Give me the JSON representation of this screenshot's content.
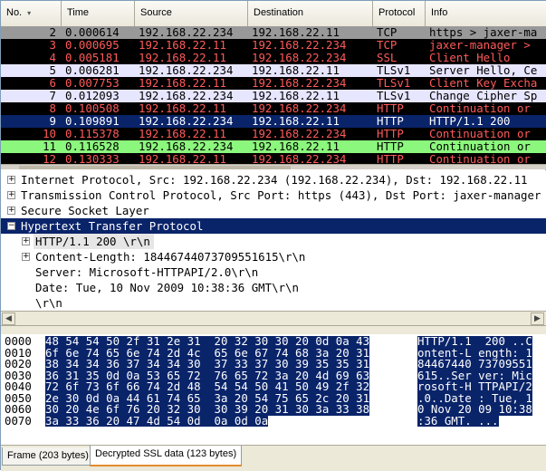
{
  "packet_list": {
    "columns": [
      "No.",
      "Time",
      "Source",
      "Destination",
      "Protocol",
      "Info"
    ],
    "sort_icon": "▾",
    "rows": [
      {
        "no": "2",
        "time": "0.000614",
        "src": "192.168.22.234",
        "dst": "192.168.22.11",
        "proto": "TCP",
        "info": "https > jaxer-ma",
        "bg": "#999999",
        "fg": "#000000"
      },
      {
        "no": "3",
        "time": "0.000695",
        "src": "192.168.22.11",
        "dst": "192.168.22.234",
        "proto": "TCP",
        "info": "jaxer-manager >",
        "bg": "#000000",
        "fg": "#ff5a5a"
      },
      {
        "no": "4",
        "time": "0.005181",
        "src": "192.168.22.11",
        "dst": "192.168.22.234",
        "proto": "SSL",
        "info": "Client Hello",
        "bg": "#000000",
        "fg": "#ff5a5a"
      },
      {
        "no": "5",
        "time": "0.006281",
        "src": "192.168.22.234",
        "dst": "192.168.22.11",
        "proto": "TLSv1",
        "info": "Server Hello, Ce",
        "bg": "#e7e6ff",
        "fg": "#000000"
      },
      {
        "no": "6",
        "time": "0.007753",
        "src": "192.168.22.11",
        "dst": "192.168.22.234",
        "proto": "TLSv1",
        "info": "Client Key Excha",
        "bg": "#000000",
        "fg": "#ff5a5a"
      },
      {
        "no": "7",
        "time": "0.012093",
        "src": "192.168.22.234",
        "dst": "192.168.22.11",
        "proto": "TLSv1",
        "info": "Change Cipher Sp",
        "bg": "#e7e6ff",
        "fg": "#000000"
      },
      {
        "no": "8",
        "time": "0.100508",
        "src": "192.168.22.11",
        "dst": "192.168.22.234",
        "proto": "HTTP",
        "info": "Continuation or",
        "bg": "#000000",
        "fg": "#ff5a5a"
      },
      {
        "no": "9",
        "time": "0.109891",
        "src": "192.168.22.234",
        "dst": "192.168.22.11",
        "proto": "HTTP",
        "info": "HTTP/1.1 200",
        "bg": "#0a246a",
        "fg": "#ffffff"
      },
      {
        "no": "10",
        "time": "0.115378",
        "src": "192.168.22.11",
        "dst": "192.168.22.234",
        "proto": "HTTP",
        "info": "Continuation or",
        "bg": "#000000",
        "fg": "#ff5a5a"
      },
      {
        "no": "11",
        "time": "0.116528",
        "src": "192.168.22.234",
        "dst": "192.168.22.11",
        "proto": "HTTP",
        "info": "Continuation or",
        "bg": "#8cf77d",
        "fg": "#000000"
      },
      {
        "no": "12",
        "time": "0.130333",
        "src": "192.168.22.11",
        "dst": "192.168.22.234",
        "proto": "HTTP",
        "info": "Continuation or",
        "bg": "#000000",
        "fg": "#ff5a5a"
      }
    ]
  },
  "details": {
    "expanded_icon": "−",
    "collapsed_icon": "+",
    "rows": [
      {
        "text": "Internet Protocol, Src: 192.168.22.234 (192.168.22.234), Dst: 192.168.22.11",
        "level": 0,
        "expander": "+",
        "selected": ""
      },
      {
        "text": "Transmission Control Protocol, Src Port: https (443), Dst Port: jaxer-manager",
        "level": 0,
        "expander": "+",
        "selected": ""
      },
      {
        "text": "Secure Socket Layer",
        "level": 0,
        "expander": "+",
        "selected": ""
      },
      {
        "text": "Hypertext Transfer Protocol",
        "level": 0,
        "expander": "−",
        "selected": "dark"
      },
      {
        "text": "HTTP/1.1 200 \\r\\n",
        "level": 1,
        "expander": "+",
        "selected": "light"
      },
      {
        "text": "Content-Length: 18446744073709551615\\r\\n",
        "level": 1,
        "expander": "+",
        "selected": ""
      },
      {
        "text": "Server: Microsoft-HTTPAPI/2.0\\r\\n",
        "level": 1,
        "expander": "",
        "selected": ""
      },
      {
        "text": "Date: Tue, 10 Nov 2009 10:38:36 GMT\\r\\n",
        "level": 1,
        "expander": "",
        "selected": ""
      },
      {
        "text": "\\r\\n",
        "level": 1,
        "expander": "",
        "selected": ""
      }
    ]
  },
  "scrollbar": {
    "left_arrow": "◀",
    "right_arrow": "▶"
  },
  "bytes": {
    "rows": [
      {
        "offset": "0000",
        "hex": "48 54 54 50 2f 31 2e 31  20 32 30 30 20 0d 0a 43",
        "ascii": "HTTP/1.1  200 ..C"
      },
      {
        "offset": "0010",
        "hex": "6f 6e 74 65 6e 74 2d 4c  65 6e 67 74 68 3a 20 31",
        "ascii": "ontent-L ength: 1"
      },
      {
        "offset": "0020",
        "hex": "38 34 34 36 37 34 34 30  37 33 37 30 39 35 35 31",
        "ascii": "84467440 73709551"
      },
      {
        "offset": "0030",
        "hex": "36 31 35 0d 0a 53 65 72  76 65 72 3a 20 4d 69 63",
        "ascii": "615..Ser ver: Mic"
      },
      {
        "offset": "0040",
        "hex": "72 6f 73 6f 66 74 2d 48  54 54 50 41 50 49 2f 32",
        "ascii": "rosoft-H TTPAPI/2"
      },
      {
        "offset": "0050",
        "hex": "2e 30 0d 0a 44 61 74 65  3a 20 54 75 65 2c 20 31",
        "ascii": ".0..Date : Tue, 1"
      },
      {
        "offset": "0060",
        "hex": "30 20 4e 6f 76 20 32 30  30 39 20 31 30 3a 33 38",
        "ascii": "0 Nov 20 09 10:38"
      },
      {
        "offset": "0070",
        "hex": "3a 33 36 20 47 4d 54 0d  0a 0d 0a",
        "ascii": ":36 GMT. ..."
      }
    ]
  },
  "tabs": [
    {
      "label": "Frame (203 bytes)",
      "active": false
    },
    {
      "label": "Decrypted SSL data (123 bytes)",
      "active": true
    }
  ]
}
